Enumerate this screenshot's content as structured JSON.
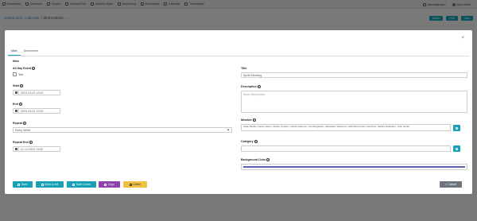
{
  "navbar": {
    "items": [
      {
        "label": "Dashboard",
        "icon": "home-icon"
      },
      {
        "label": "Customer",
        "icon": "user-icon"
      },
      {
        "label": "Vendor",
        "icon": "truck-icon"
      },
      {
        "label": "Contract File",
        "icon": "file-icon"
      },
      {
        "label": "Address Book",
        "icon": "book-icon"
      },
      {
        "label": "Accounting",
        "icon": "calculator-icon"
      },
      {
        "label": "Employees",
        "icon": "users-icon"
      },
      {
        "label": "Calendar",
        "icon": "calendar-icon"
      },
      {
        "label": "Timekeeper",
        "icon": "clock-icon"
      }
    ],
    "admin_label": "Administration",
    "user_label": "John Smith"
  },
  "page": {
    "breadcrumb": "Dashboard / Calendar",
    "record": "/ 8840e38431 ...",
    "buttons": [
      "Action",
      "Print",
      "New"
    ]
  },
  "modal": {
    "close": "×",
    "tabs": [
      "Main",
      "Documents"
    ],
    "section": "Main",
    "left": {
      "all_day_label": "All Day Event",
      "all_day_checkbox_text": "Yes",
      "start_label": "Start",
      "start_value": "2023-03-02 12:00",
      "end_label": "End",
      "end_value": "2023-03-02 12:00",
      "repeat_label": "Repeat",
      "repeat_value": "Every Week",
      "repeat_end_label": "Repeat End",
      "repeat_end_value": "31.12.2025 13:00"
    },
    "right": {
      "title_label": "Title",
      "title_value": "Sprint Meeting",
      "description_label": "Description",
      "description_placeholder": "Short Description",
      "member_label": "Member",
      "member_value": "Sean Banks, Dave Carton, Austin Cooper, Celine Fairmum, Keri Engelsen, Alexander Vancuren, Mia McConnell, Lila Price, Felicia Robinson, John Smith",
      "category_label": "Category",
      "category_value": "",
      "bg_color_label": "Background Color",
      "bg_color": "#5a5fb0"
    },
    "buttons": {
      "save": "Save",
      "save_exit": "Save & exit",
      "save_new": "Save & new",
      "copy": "Copy",
      "delete": "Delete",
      "cancel": "Cancel"
    },
    "info_glyph": "i"
  },
  "colors": {
    "teal": "#17a2b8",
    "purple": "#8e44ad",
    "yellow": "#f0c040",
    "gray": "#6c757d"
  }
}
